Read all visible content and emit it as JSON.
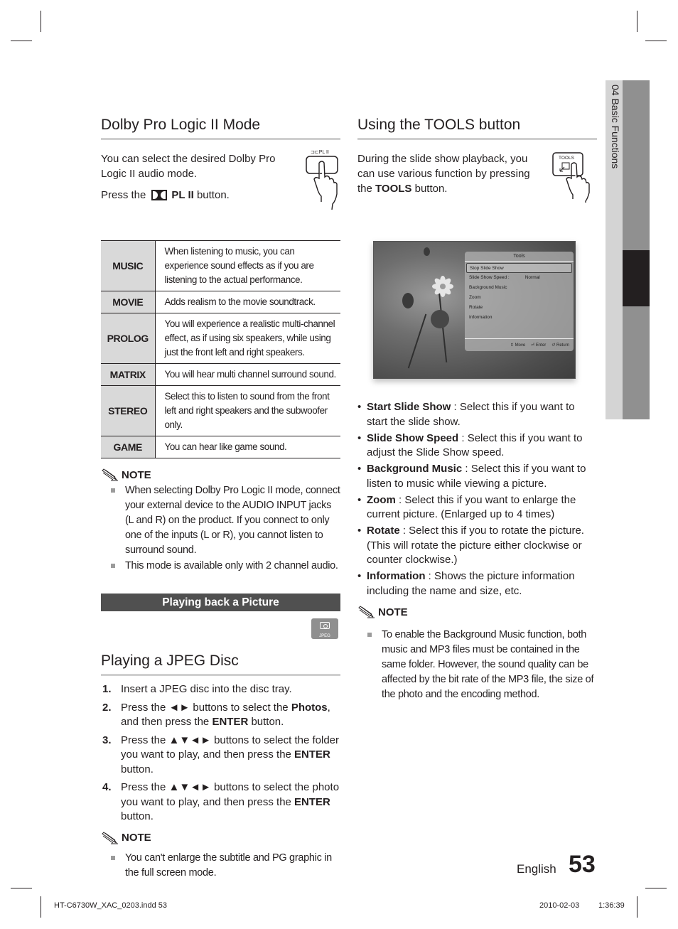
{
  "left_column": {
    "dolby": {
      "title": "Dolby Pro Logic II Mode",
      "intro": "You can select the desired Dolby Pro Logic II audio mode.",
      "press_prefix": "Press the",
      "press_button": "PL II",
      "press_suffix": "button.",
      "remote_button_label": "PL II",
      "modes": [
        {
          "name": "MUSIC",
          "desc": "When listening to music, you can experience sound effects as if you are listening to the actual performance."
        },
        {
          "name": "MOVIE",
          "desc": "Adds realism to the movie soundtrack."
        },
        {
          "name": "PROLOG",
          "desc": "You will experience a realistic multi-channel effect, as if using six speakers, while using just the front left and right speakers."
        },
        {
          "name": "MATRIX",
          "desc": "You will hear multi channel surround sound."
        },
        {
          "name": "STEREO",
          "desc": "Select this to listen to sound from the front left and right speakers and the subwoofer only."
        },
        {
          "name": "GAME",
          "desc": "You can hear like game sound."
        }
      ],
      "note": {
        "label": "NOTE",
        "items": [
          "When selecting Dolby Pro Logic II mode, connect your external device to the AUDIO INPUT jacks (L and R) on the product. If you connect to only one of the inputs (L or R), you cannot listen to surround sound.",
          "This mode is available only with 2 channel audio."
        ]
      }
    },
    "section_bar": "Playing back a Picture",
    "jpeg_badge": "JPEG",
    "jpeg": {
      "title": "Playing a JPEG Disc",
      "steps": [
        {
          "num": "1.",
          "parts": [
            {
              "t": "Insert a JPEG disc into the disc tray."
            }
          ]
        },
        {
          "num": "2.",
          "parts": [
            {
              "t": "Press the ◄► buttons to select the "
            },
            {
              "b": "Photos"
            },
            {
              "t": ", and then press the "
            },
            {
              "b": "ENTER"
            },
            {
              "t": " button."
            }
          ]
        },
        {
          "num": "3.",
          "parts": [
            {
              "t": "Press the ▲▼◄► buttons to select the folder you want to play, and then press the "
            },
            {
              "b": "ENTER"
            },
            {
              "t": " button."
            }
          ]
        },
        {
          "num": "4.",
          "parts": [
            {
              "t": "Press the ▲▼◄► buttons to select the photo you want to play, and then press the "
            },
            {
              "b": "ENTER"
            },
            {
              "t": " button."
            }
          ]
        }
      ],
      "note": {
        "label": "NOTE",
        "items": [
          "You can't enlarge the subtitle and PG graphic in the full screen mode."
        ]
      }
    }
  },
  "right_column": {
    "title": "Using the TOOLS button",
    "intro_prefix": "During the slide show playback, you can use various function by pressing the ",
    "intro_bold": "TOOLS",
    "intro_suffix": " button.",
    "remote_button_label": "TOOLS",
    "screen": {
      "panel_title": "Tools",
      "items": [
        {
          "label": "Stop Slide Show",
          "value": "",
          "selected": true
        },
        {
          "label": "Slide Show Speed :",
          "value": "Normal",
          "selected": false
        },
        {
          "label": "Background Music",
          "value": "",
          "selected": false
        },
        {
          "label": "Zoom",
          "value": "",
          "selected": false
        },
        {
          "label": "Rotate",
          "value": "",
          "selected": false
        },
        {
          "label": "Information",
          "value": "",
          "selected": false
        }
      ],
      "footer": {
        "move": "Move",
        "enter": "Enter",
        "return": "Return"
      }
    },
    "features": [
      {
        "term": "Start Slide Show",
        "desc": " : Select this if you want to start the slide show."
      },
      {
        "term": "Slide Show Speed",
        "desc": " : Select this if you want to adjust the Slide Show speed."
      },
      {
        "term": "Background Music",
        "desc": " : Select this if you want to listen to music while viewing a picture."
      },
      {
        "term": "Zoom",
        "desc": " : Select this if you want to enlarge the current picture. (Enlarged up to 4 times)"
      },
      {
        "term": "Rotate",
        "desc": " : Select this if you to rotate the picture. (This will rotate the picture either clockwise or counter clockwise.)"
      },
      {
        "term": "Information",
        "desc": " : Shows the picture information including the name and size, etc."
      }
    ],
    "note": {
      "label": "NOTE",
      "items": [
        "To enable the Background Music function, both music and MP3 files must be contained in the same folder. However, the sound quality can be affected by the bit rate of the MP3 file, the size of the photo and the encoding method."
      ]
    }
  },
  "side_tab": {
    "label": "04  Basic Functions"
  },
  "footer": {
    "language": "English",
    "page_number": "53",
    "file_slug": "HT-C6730W_XAC_0203.indd   53",
    "date": "2010-02-03",
    "time": "1:36:39"
  }
}
